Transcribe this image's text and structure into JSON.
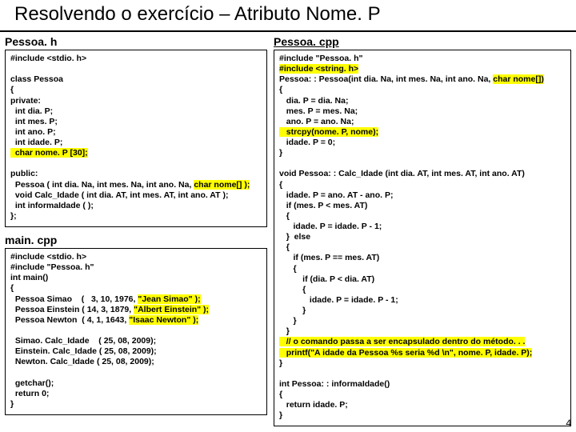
{
  "title": "Resolvendo o exercício – Atributo Nome. P",
  "pageNum": "4",
  "labels": {
    "h": "Pessoa. h",
    "cpp": "Pessoa. cpp",
    "main": "main. cpp"
  },
  "code": {
    "h_inc": "#include <stdio. h>",
    "h1": "class Pessoa\n{\nprivate:",
    "h2": "  int dia. P;\n  int mes. P;\n  int ano. P;\n  int idade. P;",
    "h_nome": "  char nome. P [30];",
    "h3": "public:",
    "h_ctor_a": "  Pessoa ( int dia. Na, int mes. Na, int ano. Na, ",
    "h_ctor_b": "char nome[] );",
    "h4": "  void Calc_Idade ( int dia. AT, int mes. AT, int ano. AT );\n  int informaIdade ( );\n};",
    "m1": "#include <stdio. h>\n#include \"Pessoa. h\"\nint main()\n{",
    "m2a": "  Pessoa Simao    (   3, 10, 1976, ",
    "m2b": "\"Jean Simao\" );",
    "m3a": "  Pessoa Einstein ( 14, 3, 1879, ",
    "m3b": "\"Albert Einstein\" );",
    "m4a": "  Pessoa Newton  ( 4, 1, 1643, ",
    "m4b": "\"Isaac Newton\" );",
    "m5": "\n  Simao. Calc_Idade    ( 25, 08, 2009);\n  Einstein. Calc_Idade ( 25, 08, 2009);\n  Newton. Calc_Idade ( 25, 08, 2009);\n\n  getchar();\n  return 0;\n}",
    "c_inc1": "#include \"Pessoa. h\"",
    "c_inc2": "#include <string. h>",
    "c_ctor_sig_a": "Pessoa: : Pessoa(int dia. Na, int mes. Na, int ano. Na, ",
    "c_ctor_sig_b": "char nome[])",
    "c_body1": "{\n   dia. P = dia. Na;\n   mes. P = mes. Na;\n   ano. P = ano. Na;",
    "c_strcpy": "   strcpy(nome. P, nome);",
    "c_body2": "   idade. P = 0;\n}",
    "c_calc": "\nvoid Pessoa: : Calc_Idade (int dia. AT, int mes. AT, int ano. AT)\n{\n   idade. P = ano. AT - ano. P;\n   if (mes. P < mes. AT)\n   {\n      idade. P = idade. P - 1;\n   }  else\n   {\n      if (mes. P == mes. AT)\n      {\n          if (dia. P < dia. AT)\n          {\n             idade. P = idade. P - 1;\n          }\n      }\n   }",
    "c_comment": "   // o comando passa a ser encapsulado dentro do método. . .",
    "c_printf": "   printf(\"A idade da Pessoa %s seria %d \\n\", nome. P, idade. P);",
    "c_end": "}\n\nint Pessoa: : informaIdade()\n{\n   return idade. P;\n}"
  }
}
